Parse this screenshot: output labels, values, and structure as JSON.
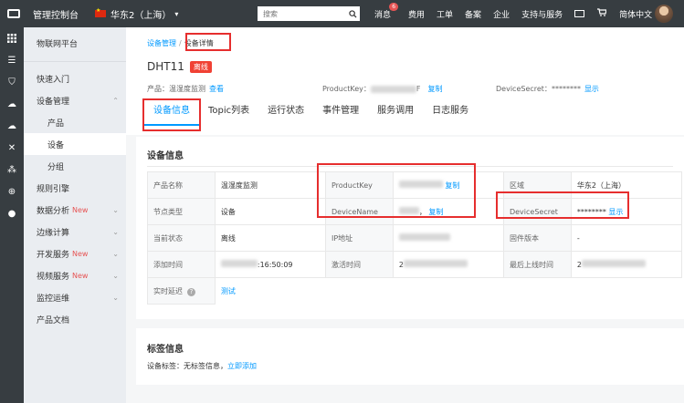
{
  "topbar": {
    "title": "管理控制台",
    "region": "华东2（上海）",
    "search_placeholder": "搜索",
    "links": [
      {
        "name": "messages",
        "label": "消息",
        "badge": "6"
      },
      {
        "name": "billing",
        "label": "费用"
      },
      {
        "name": "tickets",
        "label": "工单"
      },
      {
        "name": "icp",
        "label": "备案"
      },
      {
        "name": "enterprise",
        "label": "企业"
      },
      {
        "name": "support",
        "label": "支持与服务"
      }
    ],
    "language": "简体中文"
  },
  "sidebar": {
    "header": "物联网平台",
    "items": [
      {
        "label": "快速入门",
        "level": 0
      },
      {
        "label": "设备管理",
        "level": 0,
        "expanded": true
      },
      {
        "label": "产品",
        "level": 1
      },
      {
        "label": "设备",
        "level": 1,
        "active": true
      },
      {
        "label": "分组",
        "level": 1
      },
      {
        "label": "规则引擎",
        "level": 0
      },
      {
        "label": "数据分析",
        "level": 0,
        "new": "New",
        "chevron": true
      },
      {
        "label": "边缘计算",
        "level": 0,
        "chevron": true
      },
      {
        "label": "开发服务",
        "level": 0,
        "new": "New",
        "chevron": true
      },
      {
        "label": "视频服务",
        "level": 0,
        "new": "New",
        "chevron": true
      },
      {
        "label": "监控运维",
        "level": 0,
        "chevron": true
      },
      {
        "label": "产品文档",
        "level": 0
      }
    ]
  },
  "breadcrumb": {
    "parent": "设备管理",
    "current": "设备详情"
  },
  "device": {
    "name": "DHT11",
    "status_tag": "离线",
    "product_label": "产品：",
    "product_value": "温湿度监测",
    "product_view": "查看",
    "productkey_label": "ProductKey：",
    "productkey_tail": "F",
    "copy": "复制",
    "devicesecret_label": "DeviceSecret：",
    "devicesecret_value": "********",
    "show": "显示"
  },
  "tabs": [
    "设备信息",
    "Topic列表",
    "运行状态",
    "事件管理",
    "服务调用",
    "日志服务"
  ],
  "device_info": {
    "title": "设备信息",
    "rows": [
      {
        "l1": "产品名称",
        "v1": "温湿度监测",
        "l2": "ProductKey",
        "v2": "",
        "v2link": "复制",
        "l3": "区域",
        "v3": "华东2（上海）"
      },
      {
        "l1": "节点类型",
        "v1": "设备",
        "l2": "DeviceName",
        "v2": "，",
        "v2link": "复制",
        "l3": "DeviceSecret",
        "v3": "********",
        "v3link": "显示"
      },
      {
        "l1": "当前状态",
        "v1": "离线",
        "l2": "IP地址",
        "v2": "",
        "l3": "固件版本",
        "v3": "-"
      },
      {
        "l1": "添加时间",
        "v1": ":16:50:09",
        "l2": "激活时间",
        "v2": "2",
        "l3": "最后上线时间",
        "v3": "2"
      },
      {
        "l1": "实时延迟",
        "v1": "测试"
      }
    ]
  },
  "tag_info": {
    "title": "标签信息",
    "label": "设备标签：无标签信息，",
    "link": "立即添加"
  }
}
